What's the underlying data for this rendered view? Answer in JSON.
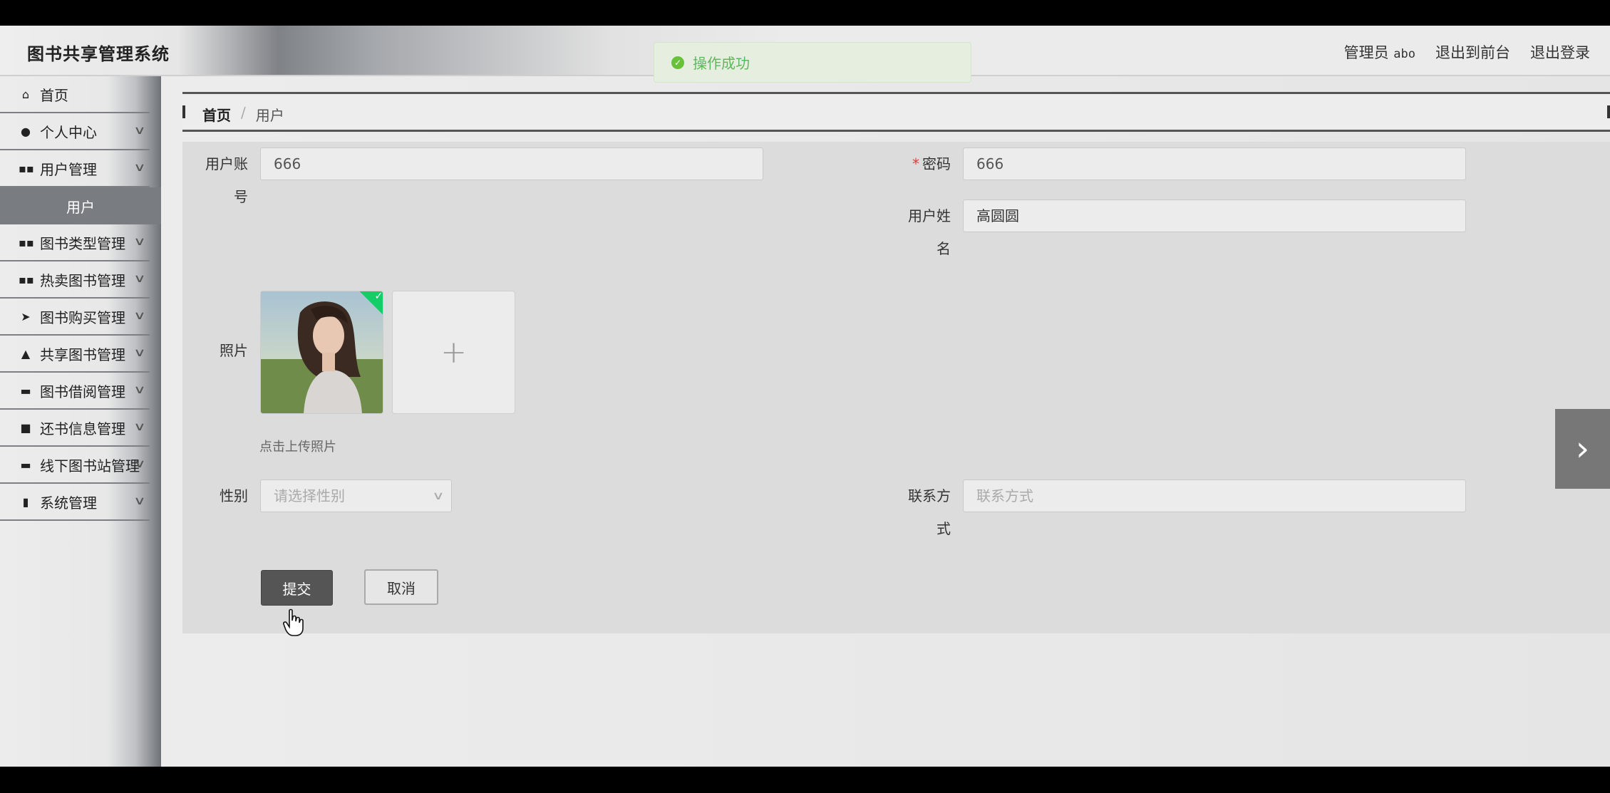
{
  "app": {
    "title": "图书共享管理系统"
  },
  "header": {
    "admin_label": "管理员",
    "admin_name": "abo",
    "front_link": "退出到前台",
    "logout_link": "退出登录"
  },
  "toast": {
    "message": "操作成功"
  },
  "sidebar": {
    "items": [
      {
        "label": "首页",
        "icon": "home-icon"
      },
      {
        "label": "个人中心",
        "icon": "person-icon"
      },
      {
        "label": "用户管理",
        "icon": "grid-icon"
      },
      {
        "label": "用户",
        "icon": ""
      },
      {
        "label": "图书类型管理",
        "icon": "grid-icon"
      },
      {
        "label": "热卖图书管理",
        "icon": "grid-icon"
      },
      {
        "label": "图书购买管理",
        "icon": "send-icon"
      },
      {
        "label": "共享图书管理",
        "icon": "user-icon"
      },
      {
        "label": "图书借阅管理",
        "icon": "briefcase-icon"
      },
      {
        "label": "还书信息管理",
        "icon": "monitor-icon"
      },
      {
        "label": "线下图书站管理",
        "icon": "ticket-icon"
      },
      {
        "label": "系统管理",
        "icon": "bar-chart-icon"
      }
    ]
  },
  "breadcrumb": {
    "home": "首页",
    "separator": "/",
    "current": "用户"
  },
  "form": {
    "account_label_1": "用户账",
    "account_label_2": "号",
    "account_value": "666",
    "password_required": "*",
    "password_label": "密码",
    "password_value": "666",
    "name_label_1": "用户姓",
    "name_label_2": "名",
    "name_value": "高圆圆",
    "photo_label": "照片",
    "upload_plus": "+",
    "upload_tip": "点击上传照片",
    "gender_label": "性别",
    "gender_placeholder": "请选择性别",
    "contact_label_1": "联系方",
    "contact_label_2": "式",
    "contact_placeholder": "联系方式",
    "submit_label": "提交",
    "cancel_label": "取消"
  },
  "colors": {
    "success": "#67c23a",
    "sidebar_active": "#797d82",
    "submit_bg": "#555555"
  }
}
